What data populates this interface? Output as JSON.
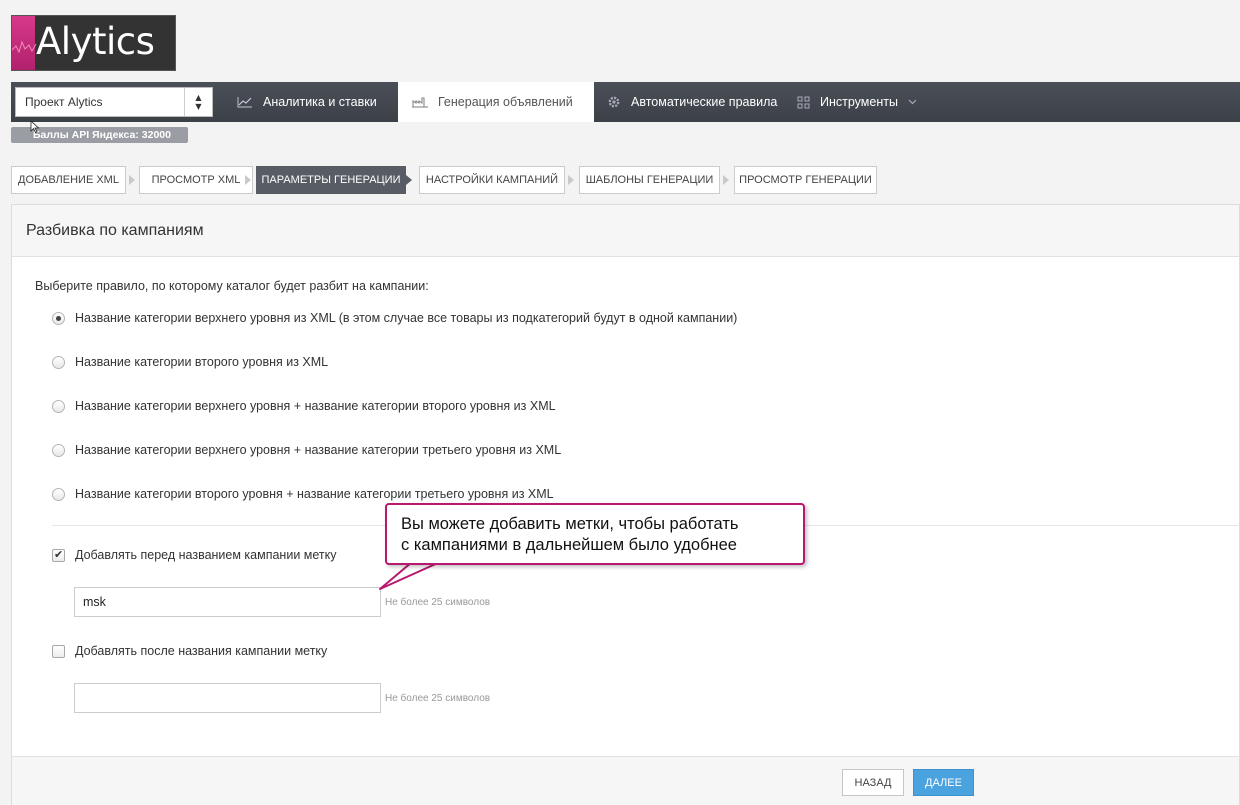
{
  "logo": {
    "text": "Alytics"
  },
  "project_select": {
    "value": "Проект Alytics"
  },
  "nav": {
    "items": [
      {
        "label": "Аналитика и ставки"
      },
      {
        "label": "Генерация объявлений"
      },
      {
        "label": "Автоматические правила"
      },
      {
        "label": "Инструменты"
      }
    ]
  },
  "api_badge": "Баллы API Яндекса: 32000",
  "steps": [
    {
      "label": "ДОБАВЛЕНИЕ XML"
    },
    {
      "label": "ПРОСМОТР XML"
    },
    {
      "label": "ПАРАМЕТРЫ ГЕНЕРАЦИИ"
    },
    {
      "label": "НАСТРОЙКИ КАМПАНИЙ"
    },
    {
      "label": "ШАБЛОНЫ ГЕНЕРАЦИИ"
    },
    {
      "label": "ПРОСМОТР ГЕНЕРАЦИИ"
    }
  ],
  "panel": {
    "title": "Разбивка по кампаниям",
    "prompt": "Выберите правило, по которому каталог будет разбит на кампании:",
    "options": [
      {
        "label": "Название категории верхнего уровня из XML (в этом случае все товары из подкатегорий будут в одной кампании)",
        "checked": true
      },
      {
        "label": "Название категории второго уровня из XML",
        "checked": false
      },
      {
        "label": "Название категории верхнего уровня + название категории второго уровня из XML",
        "checked": false
      },
      {
        "label": "Название категории верхнего уровня + название категории третьего уровня из XML",
        "checked": false
      },
      {
        "label": "Название категории второго уровня + название категории третьего уровня из XML",
        "checked": false
      }
    ],
    "prefix": {
      "label": "Добавлять перед названием кампании метку",
      "checked": true,
      "value": "msk",
      "hint": "Не более 25 символов"
    },
    "suffix": {
      "label": "Добавлять после названия кампании метку",
      "checked": false,
      "value": "",
      "hint": "Не более 25 символов"
    }
  },
  "footer": {
    "back_label": "НАЗАД",
    "next_label": "ДАЛЕЕ"
  },
  "callout": {
    "line1": "Вы можете добавить метки, чтобы работать",
    "line2": "с кампаниями в дальнейшем было удобнее"
  },
  "colors": {
    "accent_magenta": "#b9186f",
    "primary_blue": "#4aa3df",
    "nav_dark": "#3c4047"
  }
}
